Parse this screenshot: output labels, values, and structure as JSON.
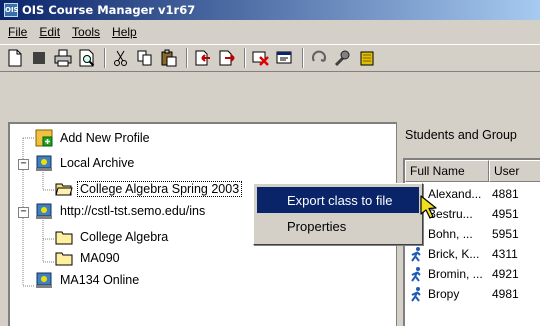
{
  "window": {
    "title": "OIS Course Manager v1r67",
    "icon_text": "OIS"
  },
  "menu": [
    {
      "label": "File"
    },
    {
      "label": "Edit"
    },
    {
      "label": "Tools"
    },
    {
      "label": "Help"
    }
  ],
  "toolbar": {
    "buttons": [
      "new-document-icon",
      "stop-icon",
      "print-icon",
      "print-preview-icon",
      "cut-icon",
      "copy-icon",
      "paste-icon",
      "import-icon",
      "export-icon",
      "delete-icon",
      "properties-icon",
      "refresh-icon",
      "search-icon",
      "database-icon"
    ]
  },
  "tree": {
    "items": [
      {
        "label": "Add New Profile",
        "icon": "add-profile-icon"
      },
      {
        "label": "Local Archive",
        "icon": "archive-icon",
        "expander": "−"
      },
      {
        "label": "College Algebra Spring 2003",
        "icon": "open-folder-icon",
        "selected": true
      },
      {
        "label": "http://cstl-tst.semo.edu/ins",
        "icon": "server-icon",
        "expander": "−"
      },
      {
        "label": "College Algebra",
        "icon": "folder-icon"
      },
      {
        "label": "MA090",
        "icon": "folder-icon"
      },
      {
        "label": "MA134 Online",
        "icon": "server-icon"
      }
    ]
  },
  "right_panel": {
    "group_title": "Students and Group",
    "columns": [
      "Full Name",
      "User"
    ],
    "rows": [
      {
        "name": "Alexand...",
        "user": "4881"
      },
      {
        "name": "Bestru...",
        "user": "4951"
      },
      {
        "name": "Bohn, ...",
        "user": "5951"
      },
      {
        "name": "Brick, K...",
        "user": "4311"
      },
      {
        "name": "Bromin, ...",
        "user": "4921"
      },
      {
        "name": "Bropy",
        "user": "4981"
      }
    ]
  },
  "context_menu": {
    "items": [
      {
        "label": "Export class to file",
        "highlighted": true
      },
      {
        "label": "Properties",
        "highlighted": false
      }
    ]
  },
  "colors": {
    "title_start": "#0a246a",
    "title_end": "#a6caf0",
    "selection": "#0a246a",
    "face": "#d4d0c8",
    "person_icon": "#1e5ab4"
  }
}
